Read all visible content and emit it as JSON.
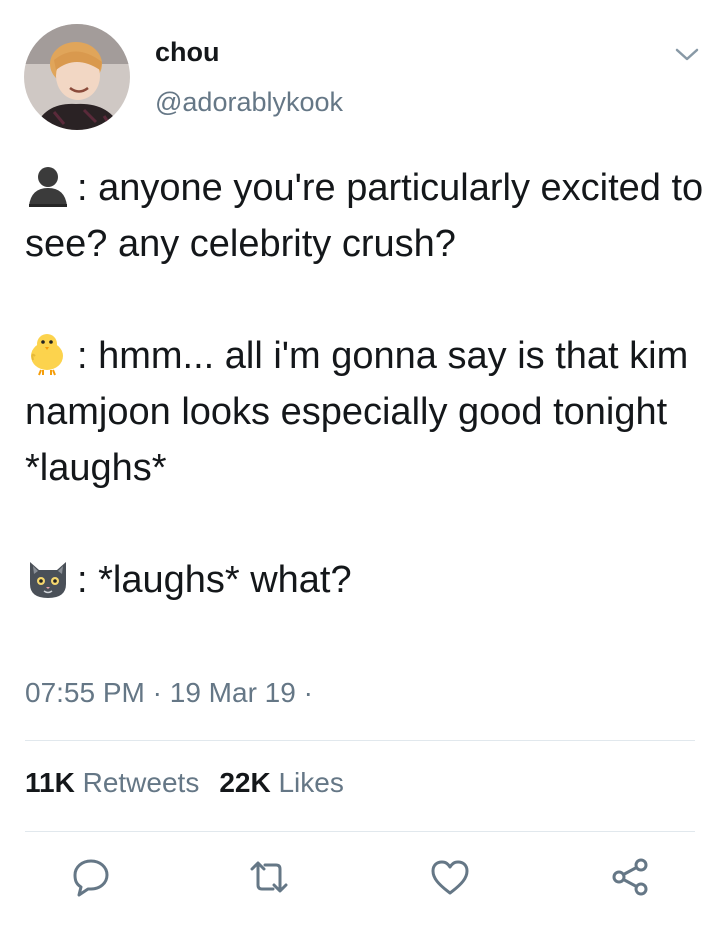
{
  "tweet": {
    "display_name": "chou",
    "handle": "@adorablykook",
    "paragraphs": [
      {
        "emoji": "bust-silhouette-emoji",
        "text": ": anyone you're particularly excited to see? any celebrity crush?"
      },
      {
        "emoji": "baby-chick-emoji",
        "text": ": hmm... all i'm gonna say is that kim namjoon looks especially good tonight *laughs*"
      },
      {
        "emoji": "cat-face-emoji",
        "text": ": *laughs* what?"
      }
    ],
    "time": "07:55 PM",
    "separator": "·",
    "date": "19 Mar 19",
    "trailing_separator": "·"
  },
  "stats": {
    "retweets_count": "11K",
    "retweets_label": "Retweets",
    "likes_count": "22K",
    "likes_label": "Likes"
  },
  "actions": [
    "reply-icon",
    "retweet-icon",
    "like-icon",
    "share-icon"
  ],
  "colors": {
    "text": "#14171a",
    "secondary": "#657786",
    "divider": "#e1e8ed"
  }
}
